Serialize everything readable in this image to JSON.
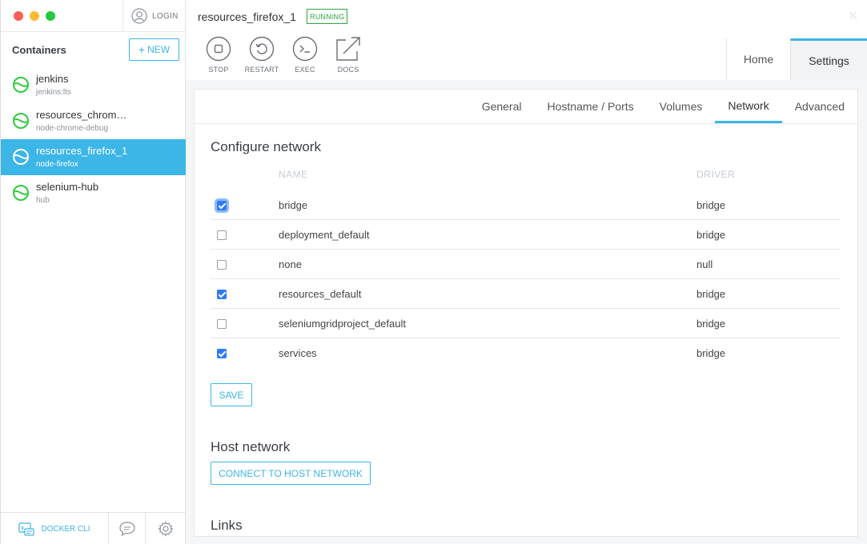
{
  "sidebar": {
    "login_label": "LOGIN",
    "containers_title": "Containers",
    "new_button_label": "NEW",
    "containers": [
      {
        "name": "jenkins",
        "image": "jenkins:lts"
      },
      {
        "name": "resources_chrom…",
        "image": "node-chrome-debug"
      },
      {
        "name": "resources_firefox_1",
        "image": "node-firefox"
      },
      {
        "name": "selenium-hub",
        "image": "hub"
      }
    ],
    "docker_cli_label": "DOCKER CLI"
  },
  "header": {
    "container_title": "resources_firefox_1",
    "status": "RUNNING",
    "logo": "K",
    "actions": [
      {
        "label": "STOP",
        "icon": "stop-icon"
      },
      {
        "label": "RESTART",
        "icon": "restart-icon"
      },
      {
        "label": "EXEC",
        "icon": "terminal-icon"
      },
      {
        "label": "DOCS",
        "icon": "external-link-icon"
      }
    ],
    "tabs": [
      "Home",
      "Settings"
    ]
  },
  "settings": {
    "subtabs": [
      "General",
      "Hostname / Ports",
      "Volumes",
      "Network",
      "Advanced"
    ],
    "active_subtab": "Network",
    "configure_title": "Configure network",
    "columns": {
      "name": "NAME",
      "driver": "DRIVER"
    },
    "networks": [
      {
        "name": "bridge",
        "driver": "bridge",
        "checked": true
      },
      {
        "name": "deployment_default",
        "driver": "bridge",
        "checked": false
      },
      {
        "name": "none",
        "driver": "null",
        "checked": false
      },
      {
        "name": "resources_default",
        "driver": "bridge",
        "checked": true
      },
      {
        "name": "seleniumgridproject_default",
        "driver": "bridge",
        "checked": false
      },
      {
        "name": "services",
        "driver": "bridge",
        "checked": true
      }
    ],
    "save_label": "SAVE",
    "host_network_title": "Host network",
    "connect_host_label": "CONNECT TO HOST NETWORK",
    "links_title": "Links"
  },
  "colors": {
    "accent": "#3cb5e7",
    "running": "#2ca643",
    "checkbox": "#2f7bf5"
  }
}
